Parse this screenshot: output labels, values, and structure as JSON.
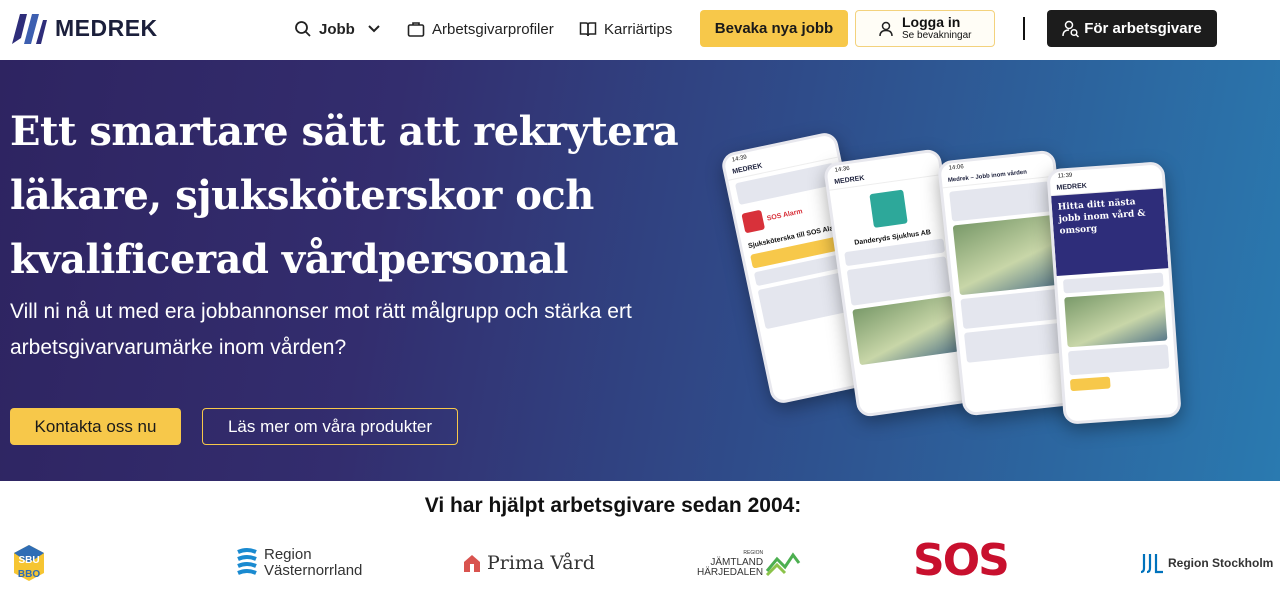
{
  "header": {
    "brand": "MEDREK",
    "nav": {
      "jobs": "Jobb",
      "profiles": "Arbetsgivarprofiler",
      "tips": "Karriärtips"
    },
    "watch_button": "Bevaka nya jobb",
    "login": {
      "title": "Logga in",
      "subtitle": "Se bevakningar"
    },
    "employer_button": "För arbetsgivare"
  },
  "hero": {
    "title_lines": [
      "Ett smartare sätt att rekrytera",
      "läkare, sjuksköterskor och",
      "kvalificerad vårdpersonal"
    ],
    "subtitle": "Vill ni nå ut med era jobbannonser mot rätt målgrupp och stärka ert arbetsgivarvarumärke inom vården?",
    "cta_primary": "Kontakta oss nu",
    "cta_secondary": "Läs mer om våra produkter",
    "phones": {
      "p1_title": "Sjuksköterska till SOS Alarm",
      "p2_title": "Danderyds Sjukhus AB",
      "p3_title": "Medrek – Jobb inom vården",
      "p4_title": "Hitta ditt nästa jobb inom vård & omsorg",
      "brand": "MEDREK"
    }
  },
  "clients": {
    "title": "Vi har hjälpt arbetsgivare sedan 2004:",
    "logos": [
      {
        "name": "SBU",
        "extra": "BBO"
      },
      {
        "name": "Region",
        "extra": "Västernorrland"
      },
      {
        "name": "Prima Vård"
      },
      {
        "name": "JÄMTLAND",
        "extra": "HÄRJEDALEN",
        "small": "REGION"
      },
      {
        "name": "SOS"
      },
      {
        "name": "Region Stockholm"
      }
    ]
  },
  "colors": {
    "accent": "#f7c84a",
    "dark": "#1c1c1c",
    "hero_start": "#2e2461",
    "hero_end": "#2a7ab0",
    "sos_red": "#c8102e",
    "region_blue": "#0072bc"
  }
}
